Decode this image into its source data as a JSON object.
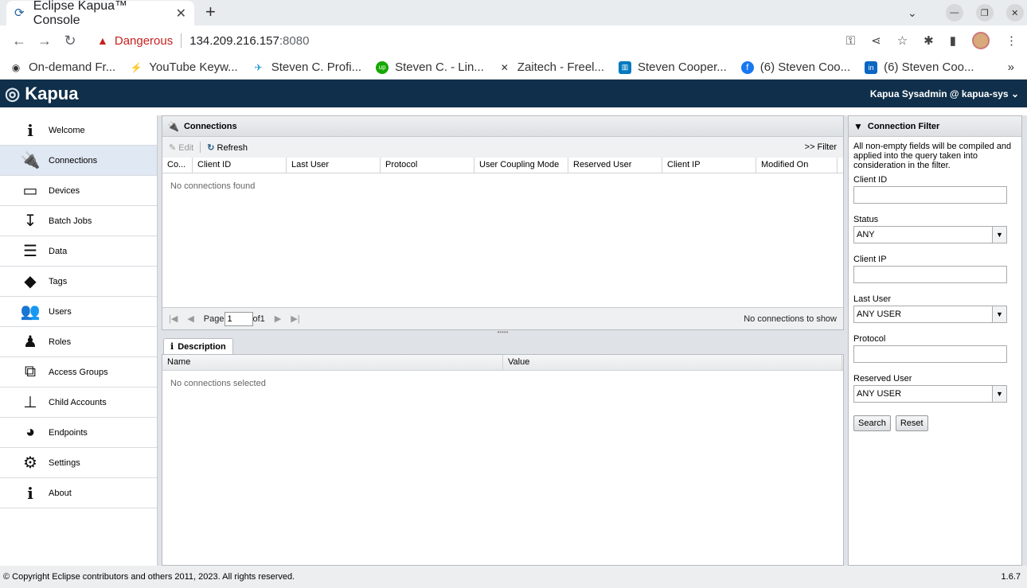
{
  "browser": {
    "tab_title": "Eclipse Kapua™ Console",
    "security_label": "Dangerous",
    "url_host": "134.209.216.157",
    "url_port": ":8080",
    "bookmarks": [
      {
        "label": "On-demand Fr...",
        "icon": "globe-icon",
        "color": "#555555"
      },
      {
        "label": "YouTube Keyw...",
        "icon": "keyword-icon",
        "color": "#7b2fd6"
      },
      {
        "label": "Steven C. Profi...",
        "icon": "bird-icon",
        "color": "#1a9ad6"
      },
      {
        "label": "Steven C. - Lin...",
        "icon": "upwork-icon",
        "color": "#14a800"
      },
      {
        "label": "Zaitech - Freel...",
        "icon": "handshake-icon",
        "color": "#333333"
      },
      {
        "label": "Steven Cooper...",
        "icon": "trello-icon",
        "color": "#0079bf"
      },
      {
        "label": "(6) Steven Coo...",
        "icon": "facebook-icon",
        "color": "#1877f2"
      },
      {
        "label": "(6) Steven Coo...",
        "icon": "linkedin-icon",
        "color": "#0a66c2"
      }
    ],
    "more_bookmarks": "»"
  },
  "app": {
    "logo_text": "Kapua",
    "user_label": "Kapua Sysadmin @ kapua-sys"
  },
  "sidebar": {
    "items": [
      {
        "label": "Welcome",
        "icon": "info-icon"
      },
      {
        "label": "Connections",
        "icon": "plug-icon"
      },
      {
        "label": "Devices",
        "icon": "device-icon"
      },
      {
        "label": "Batch Jobs",
        "icon": "batch-jobs-icon"
      },
      {
        "label": "Data",
        "icon": "database-icon"
      },
      {
        "label": "Tags",
        "icon": "tags-icon"
      },
      {
        "label": "Users",
        "icon": "users-icon"
      },
      {
        "label": "Roles",
        "icon": "roles-icon"
      },
      {
        "label": "Access Groups",
        "icon": "access-groups-icon"
      },
      {
        "label": "Child Accounts",
        "icon": "sitemap-icon"
      },
      {
        "label": "Endpoints",
        "icon": "globe-icon"
      },
      {
        "label": "Settings",
        "icon": "gear-icon"
      },
      {
        "label": "About",
        "icon": "info-icon"
      }
    ]
  },
  "connections": {
    "title": "Connections",
    "edit_label": "Edit",
    "refresh_label": "Refresh",
    "filter_label": ">> Filter",
    "columns": [
      "Co...",
      "Client ID",
      "Last User",
      "Protocol",
      "User Coupling Mode",
      "Reserved User",
      "Client IP",
      "Modified On"
    ],
    "empty_text": "No connections found",
    "page_label": "Page",
    "page_value": "1",
    "of_label": "of1",
    "pager_status": "No connections to show"
  },
  "description": {
    "tab_label": "Description",
    "columns": [
      "Name",
      "Value"
    ],
    "empty_text": "No connections selected"
  },
  "filter": {
    "title": "Connection Filter",
    "help_text": "All non-empty fields will be compiled and applied into the query taken into consideration in the filter.",
    "client_id_label": "Client ID",
    "status_label": "Status",
    "status_value": "ANY",
    "client_ip_label": "Client IP",
    "last_user_label": "Last User",
    "last_user_value": "ANY USER",
    "protocol_label": "Protocol",
    "reserved_user_label": "Reserved User",
    "reserved_user_value": "ANY USER",
    "search_label": "Search",
    "reset_label": "Reset"
  },
  "footer": {
    "copyright": "© Copyright Eclipse contributors and others 2011, 2023. All rights reserved.",
    "version": "1.6.7"
  }
}
